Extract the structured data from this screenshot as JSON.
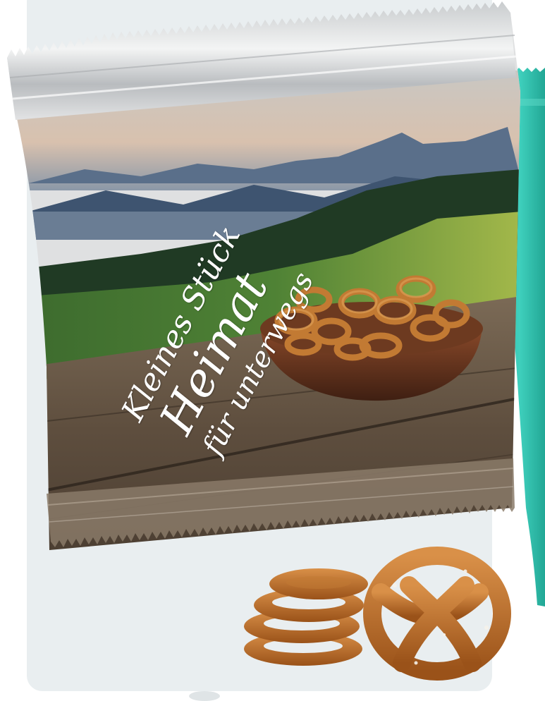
{
  "product": {
    "name": "pretzel snack bag",
    "slogan_line1": "Kleines Stück",
    "slogan_line2": "Heimat",
    "slogan_line3": "für unterwegs"
  },
  "colors": {
    "card_bg": "#e9eef0",
    "teal_pack": "#35c3b1",
    "pretzel": "#c27a33",
    "wood": "#6b5a48"
  }
}
